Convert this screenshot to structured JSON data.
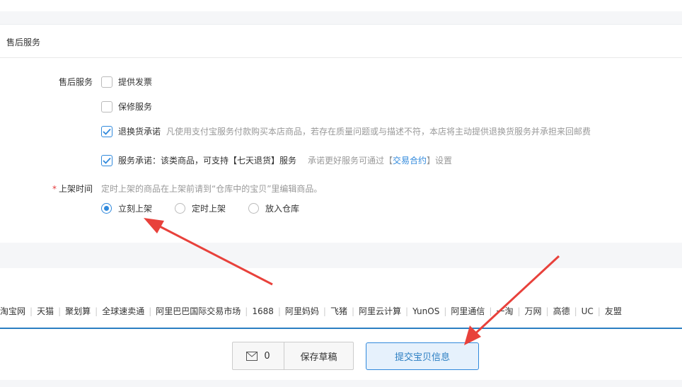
{
  "section": {
    "title": "售后服务"
  },
  "after_sale": {
    "label": "售后服务",
    "options": [
      {
        "label": "提供发票",
        "checked": false
      },
      {
        "label": "保修服务",
        "checked": false
      },
      {
        "label": "退换货承诺",
        "checked": true,
        "hint": "凡使用支付宝服务付款购买本店商品，若存在质量问题或与描述不符，本店将主动提供退换货服务并承担来回邮费"
      },
      {
        "label": "服务承诺：该类商品，可支持【七天退货】服务",
        "checked": true,
        "hint_pre": "承诺更好服务可通过【",
        "hint_link": "交易合约",
        "hint_post": "】设置"
      }
    ]
  },
  "listing_time": {
    "required_mark": "*",
    "label": "上架时间",
    "hint": "定时上架的商品在上架前请到“仓库中的宝贝”里编辑商品。",
    "options": [
      {
        "label": "立刻上架",
        "selected": true
      },
      {
        "label": "定时上架",
        "selected": false
      },
      {
        "label": "放入仓库",
        "selected": false
      }
    ]
  },
  "footer_links": [
    "淘宝网",
    "天猫",
    "聚划算",
    "全球速卖通",
    "阿里巴巴国际交易市场",
    "1688",
    "阿里妈妈",
    "飞猪",
    "阿里云计算",
    "YunOS",
    "阿里通信",
    "一淘",
    "万网",
    "高德",
    "UC",
    "友盟"
  ],
  "actions": {
    "message_count": "0",
    "save_draft": "保存草稿",
    "submit": "提交宝贝信息"
  },
  "colors": {
    "accent": "#3089dc",
    "annotation": "#e8413b"
  }
}
